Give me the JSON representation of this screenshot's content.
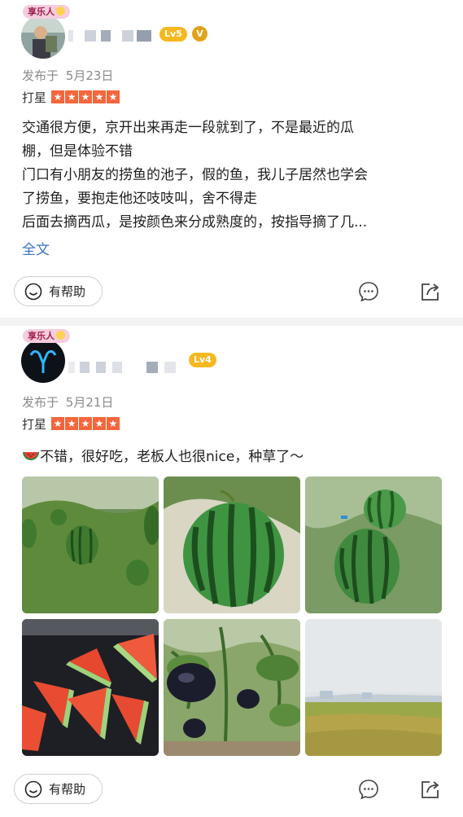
{
  "reviews": [
    {
      "user_badge": "享乐人",
      "level": "Lv5",
      "verified_mark": "V",
      "posted_label": "发布于",
      "posted_date": "5月23日",
      "rating_label": "打星",
      "rating": 5,
      "text_lines": [
        "交通很方便，京开出来再走一段就到了，不是最近的瓜",
        "棚，但是体验不错",
        "门口有小朋友的捞鱼的池子，假的鱼，我儿子居然也学会",
        "了捞鱼，要抱走他还吱吱叫，舍不得走",
        "后面去摘西瓜，是按颜色来分成熟度的，按指导摘了几..."
      ],
      "expand_label": "全文",
      "helpful_label": "有帮助"
    },
    {
      "user_badge": "享乐人",
      "level": "Lv4",
      "posted_label": "发布于",
      "posted_date": "5月21日",
      "rating_label": "打星",
      "rating": 5,
      "text": "不错，很好吃，老板人也很nice，种草了～",
      "photos": [
        "watermelons-in-field",
        "watermelon-closeup",
        "watermelons-on-vine",
        "watermelon-slices",
        "eggplants-on-plant",
        "greenhouse-farmland"
      ],
      "helpful_label": "有帮助"
    }
  ],
  "icons": {
    "helpful": "smile-icon",
    "comment": "comment-icon",
    "share": "share-icon"
  },
  "colors": {
    "star": "#f5663d",
    "level_badge": "#f5b81f",
    "link": "#3a72c8"
  }
}
